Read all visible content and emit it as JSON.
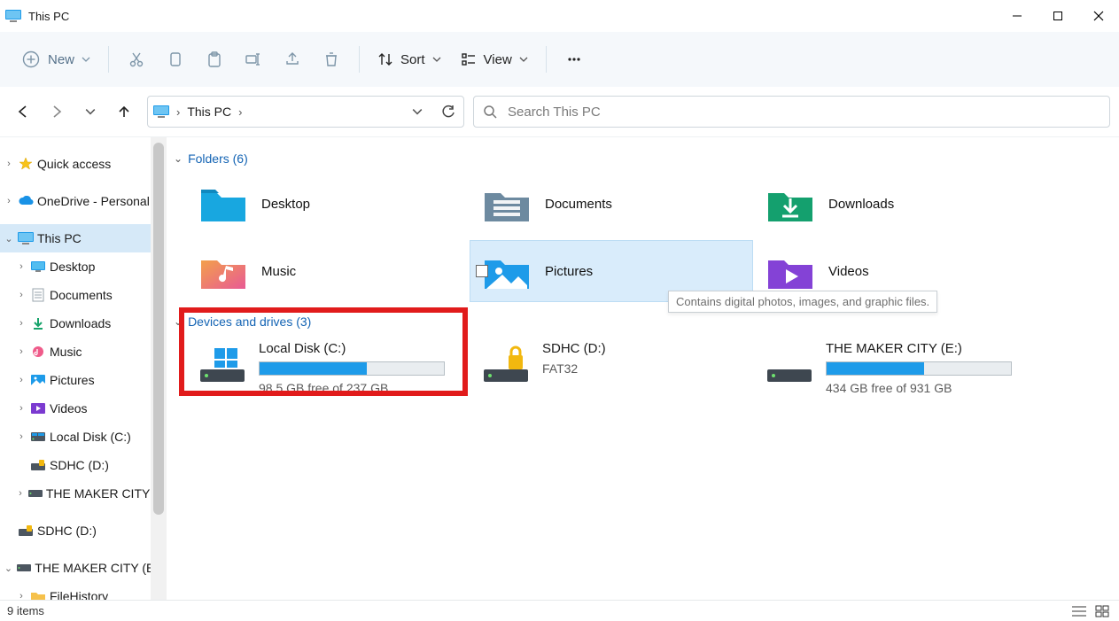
{
  "window": {
    "title": "This PC"
  },
  "toolbar": {
    "new_label": "New",
    "sort_label": "Sort",
    "view_label": "View"
  },
  "address": {
    "location": "This PC"
  },
  "search": {
    "placeholder": "Search This PC"
  },
  "tree": {
    "quick_access": "Quick access",
    "onedrive": "OneDrive - Personal",
    "this_pc": "This PC",
    "desktop": "Desktop",
    "documents": "Documents",
    "downloads": "Downloads",
    "music": "Music",
    "pictures": "Pictures",
    "videos": "Videos",
    "local_disk": "Local Disk (C:)",
    "sdhc": "SDHC (D:)",
    "maker": "THE MAKER CITY (E:)",
    "sdhc2": "SDHC (D:)",
    "maker2": "THE MAKER CITY (E:)",
    "filehistory": "FileHistory"
  },
  "groups": {
    "folders_label": "Folders (6)",
    "drives_label": "Devices and drives (3)"
  },
  "folders": {
    "desktop": "Desktop",
    "documents": "Documents",
    "downloads": "Downloads",
    "music": "Music",
    "pictures": "Pictures",
    "videos": "Videos"
  },
  "tooltip": {
    "pictures": "Contains digital photos, images, and graphic files."
  },
  "drives": {
    "c": {
      "name": "Local Disk (C:)",
      "free": "98.5 GB free of 237 GB",
      "fill_pct": 58
    },
    "d": {
      "name": "SDHC (D:)",
      "fat": "FAT32"
    },
    "e": {
      "name": "THE MAKER CITY (E:)",
      "free": "434 GB free of 931 GB",
      "fill_pct": 53
    }
  },
  "status": {
    "count": "9 items"
  }
}
